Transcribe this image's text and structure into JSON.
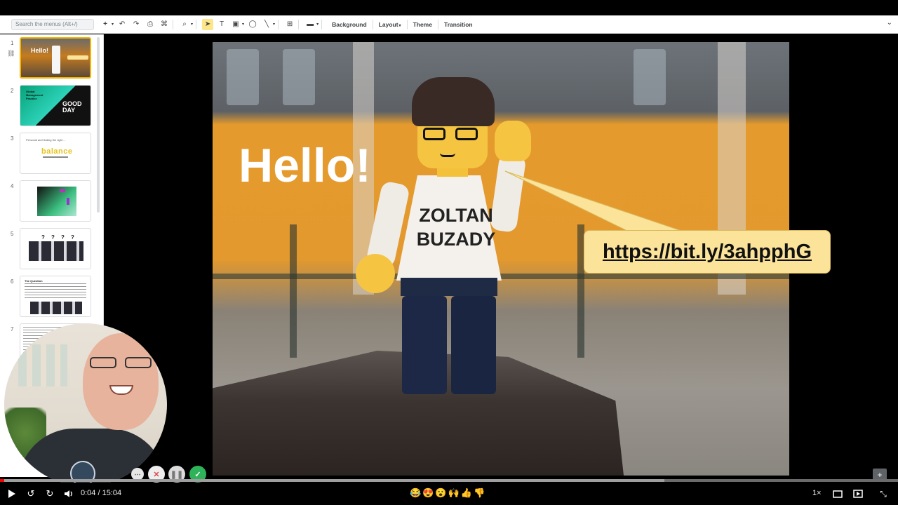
{
  "toolbar": {
    "search_placeholder": "Search the menus (Alt+/)",
    "background_label": "Background",
    "layout_label": "Layout",
    "theme_label": "Theme",
    "transition_label": "Transition"
  },
  "slides": [
    {
      "num": "1",
      "title": "Hello!"
    },
    {
      "num": "2",
      "title": "Global Management Practice",
      "right_text": "GOOD DAY"
    },
    {
      "num": "3",
      "title": "Personal and finding the right ...",
      "word": "balance"
    },
    {
      "num": "4"
    },
    {
      "num": "5"
    },
    {
      "num": "6",
      "title": "The Question"
    },
    {
      "num": "7"
    }
  ],
  "main_slide": {
    "greeting": "Hello!",
    "shirt_line1": "ZOLTAN",
    "shirt_line2": "BUZADY",
    "link": "https://bit.ly/3ahpphG"
  },
  "player": {
    "current_time": "0:04",
    "separator": "/",
    "duration": "15:04",
    "speed": "1×",
    "played_fraction": 0.0045,
    "buffered_fraction": 0.74,
    "reactions": [
      "😂",
      "😍",
      "😮",
      "🙌",
      "👍",
      "👎"
    ]
  },
  "colors": {
    "accent_played": "#ff0000",
    "bubble": "#fbe39a",
    "selected_thumb": "#f4b400",
    "done_button": "#2fb35a"
  }
}
